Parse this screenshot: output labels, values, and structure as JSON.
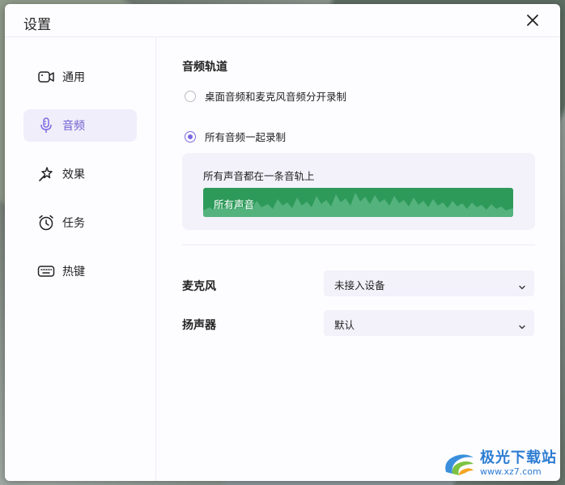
{
  "dialog": {
    "title": "设置"
  },
  "sidebar": {
    "items": [
      {
        "label": "通用",
        "icon": "camera-icon"
      },
      {
        "label": "音频",
        "icon": "microphone-icon",
        "active": true
      },
      {
        "label": "效果",
        "icon": "magic-wand-icon"
      },
      {
        "label": "任务",
        "icon": "alarm-clock-icon"
      },
      {
        "label": "热键",
        "icon": "keyboard-icon"
      }
    ]
  },
  "audio": {
    "section_title": "音频轨道",
    "options": [
      {
        "label": "桌面音频和麦克风音频分开录制",
        "checked": false
      },
      {
        "label": "所有音频一起录制",
        "checked": true
      }
    ],
    "info_text": "所有声音都在一条音轨上",
    "track_label": "所有声音",
    "microphone": {
      "label": "麦克风",
      "value": "未接入设备"
    },
    "speaker": {
      "label": "扬声器",
      "value": "默认"
    }
  },
  "watermark": {
    "text": "极光下载站",
    "url": "www.xz7.com"
  },
  "colors": {
    "accent": "#7b68e0",
    "track_green": "#2e9a5a",
    "active_bg": "#f0eefb",
    "panel_bg": "#f3f2fb"
  }
}
